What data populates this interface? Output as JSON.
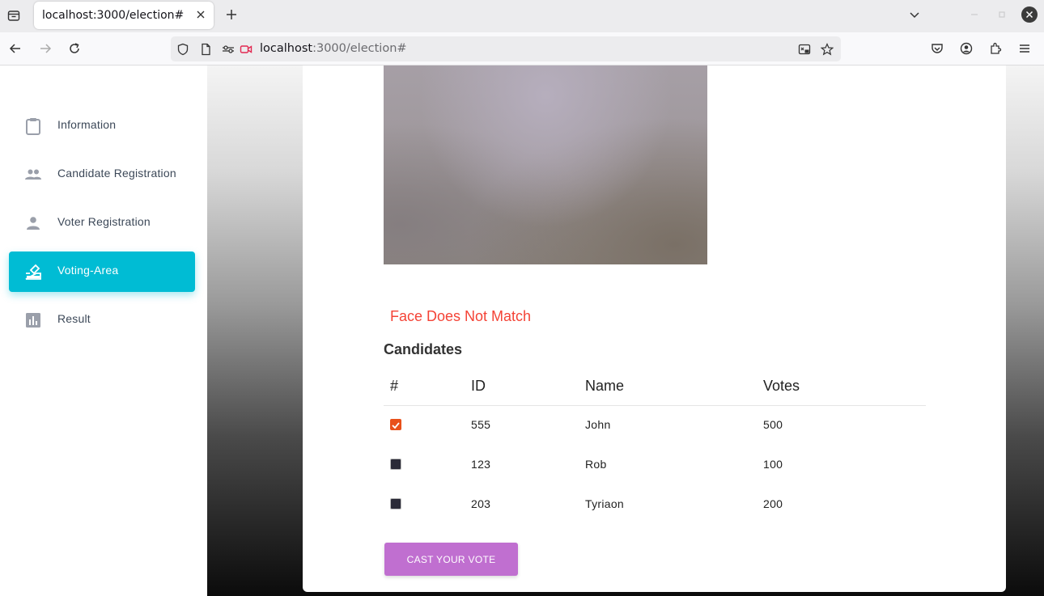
{
  "browser": {
    "tab_title": "localhost:3000/election#",
    "url_host": "localhost",
    "url_rest": ":3000/election#"
  },
  "sidebar": {
    "items": [
      {
        "label": "Information",
        "icon": "clipboard-icon"
      },
      {
        "label": "Candidate Registration",
        "icon": "people-icon"
      },
      {
        "label": "Voter Registration",
        "icon": "person-icon"
      },
      {
        "label": "Voting-Area",
        "icon": "ballot-box-icon",
        "active": true
      },
      {
        "label": "Result",
        "icon": "bar-chart-icon"
      }
    ],
    "accent_color": "#00bcd4"
  },
  "main": {
    "face_message": "Face Does Not Match",
    "candidates_title": "Candidates",
    "table": {
      "headers": [
        "#",
        "ID",
        "Name",
        "Votes"
      ],
      "rows": [
        {
          "checked": true,
          "id": "555",
          "name": "John",
          "votes": "500"
        },
        {
          "checked": false,
          "id": "123",
          "name": "Rob",
          "votes": "100"
        },
        {
          "checked": false,
          "id": "203",
          "name": "Tyriaon",
          "votes": "200"
        }
      ]
    },
    "cast_button": "CAST YOUR VOTE",
    "cast_button_color": "#c06fd0",
    "error_color": "#f44336"
  }
}
